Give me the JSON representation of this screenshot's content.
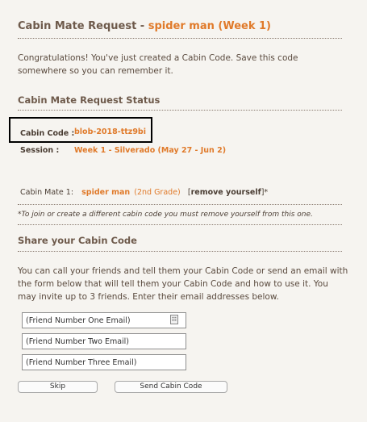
{
  "header": {
    "title_prefix": "Cabin Mate Request - ",
    "title_name": "spider man (Week 1)"
  },
  "intro_text": "Congratulations! You've just created a Cabin Code. Save this code somewhere so you can remember it.",
  "status": {
    "heading": "Cabin Mate Request Status",
    "cabin_code_label": "Cabin Code :",
    "cabin_code_value": "blob-2018-ttz9bi",
    "session_label": "Session :",
    "session_value": "Week 1 - Silverado (May 27 - Jun 2)",
    "mate_label": "Cabin Mate 1:",
    "mate_name": "spider man",
    "mate_grade": "(2nd Grade)",
    "remove_open": "[",
    "remove_label": "remove yourself",
    "remove_close": "]*",
    "note": "*To join or create a different cabin code you must remove yourself from this one."
  },
  "share": {
    "heading": "Share your Cabin Code",
    "description": "You can call your friends and tell them your Cabin Code or send an email with the form below that will tell them your Cabin Code and how to use it. You may invite up to 3 friends. Enter their email addresses below.",
    "friend1_value": "(Friend Number One Email)",
    "friend2_value": "(Friend Number Two Email)",
    "friend3_value": "(Friend Number Three Email)",
    "skip_label": "Skip",
    "send_label": "Send Cabin Code"
  },
  "icons": {
    "autofill": "contact-card-icon"
  },
  "colors": {
    "accent": "#e07a2a",
    "text": "#5a4a3e",
    "background": "#f6f4f0"
  }
}
